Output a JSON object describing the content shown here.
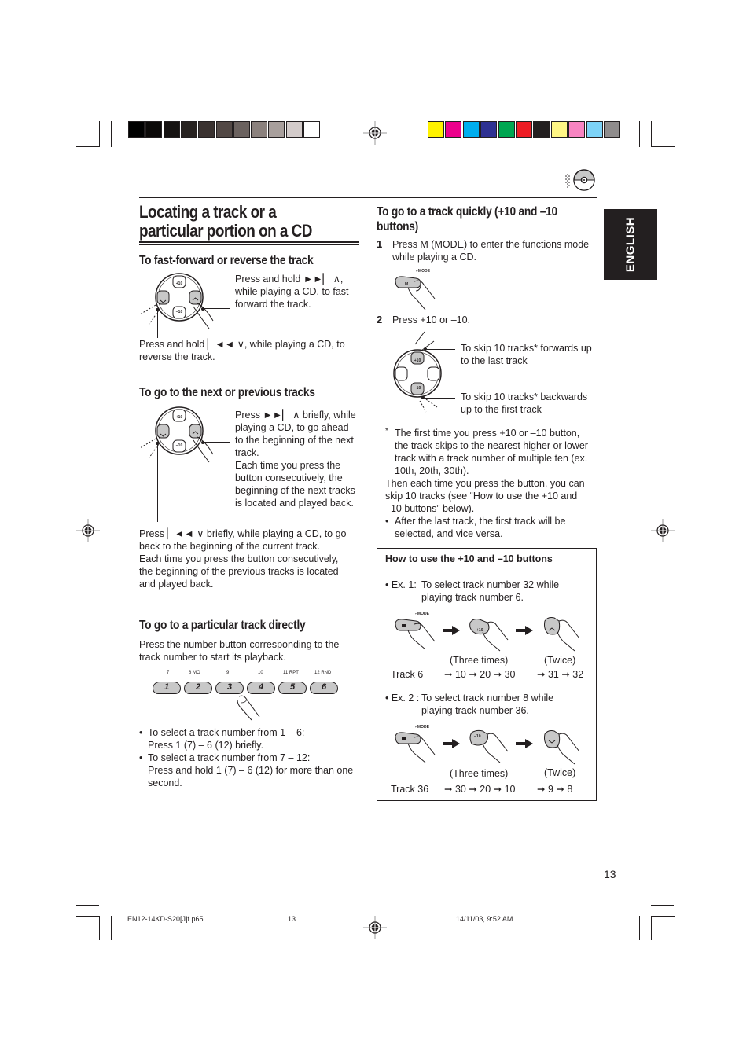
{
  "registration": {
    "grayscale_colors": [
      "#000000",
      "#0b0908",
      "#161312",
      "#272220",
      "#3a3230",
      "#524845",
      "#6b625f",
      "#8b817d",
      "#a89f9c",
      "#d3cbca",
      "#ffffff"
    ],
    "process_colors": [
      "#fff200",
      "#ec008c",
      "#00aeef",
      "#2e3192",
      "#00a651",
      "#ed1c24",
      "#231f20",
      "#fff685",
      "#f784c1",
      "#7dd3f7",
      "#8f8c8c"
    ]
  },
  "page": {
    "title_line1": "Locating a track or a",
    "title_line2": "particular portion on a CD",
    "language_tab": "ENGLISH",
    "page_number": "13",
    "cd_icon": "cd-disc-icon"
  },
  "left": {
    "ff": {
      "heading": "To fast-forward or reverse the track",
      "callout_forward": [
        "Press and hold ►►▏ ∧,",
        "while playing a CD, to fast-",
        "forward the track."
      ],
      "callout_reverse": [
        "Press and hold ▏◄◄ ∨, while playing a CD, to",
        "reverse the track."
      ]
    },
    "next": {
      "heading": "To go to the next or previous tracks",
      "callout_next": [
        "Press ►►▏ ∧ briefly, while",
        "playing a CD, to go ahead",
        "to the beginning of the next",
        "track.",
        "Each time you press the",
        "button consecutively, the",
        "beginning of the next tracks",
        "is located and played back."
      ],
      "callout_prev": [
        "Press ▏◄◄ ∨ briefly, while playing a CD, to go",
        "back to the beginning of the current track.",
        "Each time you press the button consecutively,",
        "the beginning of the previous tracks is located",
        "and played back."
      ]
    },
    "direct": {
      "heading": "To go to a particular track directly",
      "intro": [
        "Press the number button corresponding to the",
        "track number to start its playback."
      ],
      "buttons": [
        {
          "label": "1",
          "alt": "7"
        },
        {
          "label": "2",
          "alt": "8   MO"
        },
        {
          "label": "3",
          "alt": "9"
        },
        {
          "label": "4",
          "alt": "10"
        },
        {
          "label": "5",
          "alt": "11   RPT"
        },
        {
          "label": "6",
          "alt": "12   RND"
        }
      ],
      "bullets": [
        {
          "line1": "To select a track number from 1 – 6:",
          "line2": "Press 1 (7) – 6 (12) briefly."
        },
        {
          "line1": "To select a track number from 7 – 12:",
          "line2": "Press and hold 1 (7) – 6 (12) for more than one",
          "line3": "second."
        }
      ]
    }
  },
  "right": {
    "heading_line1": "To go to a track quickly (+10 and –10",
    "heading_line2": "buttons)",
    "step1": {
      "num": "1",
      "line1": "Press M (MODE) to enter the functions mode",
      "line2": "while playing a CD."
    },
    "mode_label": "MODE",
    "m_button": "M",
    "step2": {
      "num": "2",
      "text": "Press +10 or –10."
    },
    "skip_fwd": [
      "To skip 10 tracks* forwards up",
      "to the last track"
    ],
    "skip_back": [
      "To skip 10 tracks* backwards",
      "up to the first track"
    ],
    "dial_labels": {
      "plus10": "+10",
      "minus10": "–10"
    },
    "note": {
      "star": "*",
      "lines": [
        "The first time you press +10 or –10 button,",
        "the track skips to the nearest higher or lower",
        "track with a track number of multiple ten (ex.",
        "10th, 20th, 30th)."
      ],
      "then_lines": [
        "Then each time you press the button, you can",
        "skip 10 tracks (see “How to use the +10 and",
        "–10 buttons” below)."
      ],
      "bullet_lines": [
        "After the last track, the first track will be",
        "selected, and vice versa."
      ]
    },
    "howto": {
      "title": "How to use the +10 and –10 buttons",
      "ex1": {
        "label": "• Ex. 1:",
        "line1": "To select track number 32 while",
        "line2": "playing track number 6.",
        "times_a": "(Three times)",
        "times_b": "(Twice)",
        "start": "Track 6",
        "seq_a": "➞ 10 ➞ 20 ➞ 30",
        "seq_b": "➞ 31 ➞ 32"
      },
      "ex2": {
        "label": "• Ex. 2 :",
        "line1": "To select track number 8 while",
        "line2": "playing track number 36.",
        "times_a": "(Three times)",
        "times_b": "(Twice)",
        "start": "Track 36",
        "seq_a": "➞ 30 ➞ 20 ➞ 10",
        "seq_b": "➞ 9 ➞ 8"
      }
    }
  },
  "footer": {
    "file": "EN12-14KD-S20[J]f.p65",
    "page": "13",
    "timestamp": "14/11/03, 9:52 AM"
  }
}
